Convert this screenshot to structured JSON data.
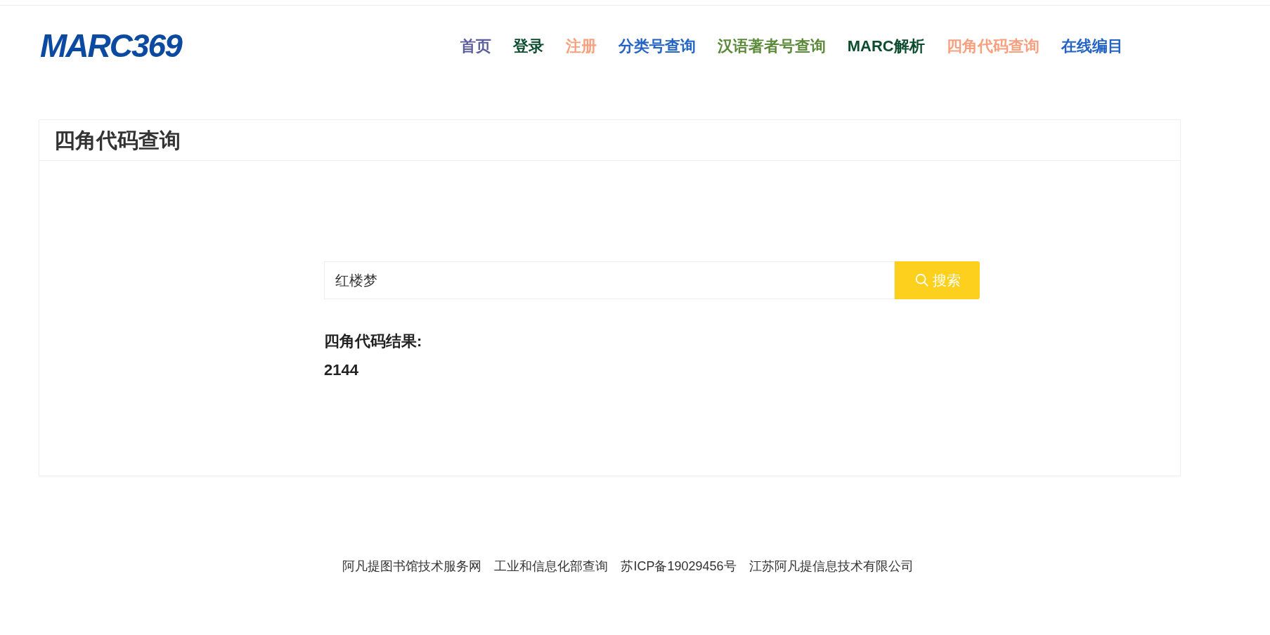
{
  "logo": {
    "text": "MARC369"
  },
  "nav": [
    {
      "label": "首页",
      "color": "#5b5fa0"
    },
    {
      "label": "登录",
      "color": "#0b4d2c"
    },
    {
      "label": "注册",
      "color": "#f8a07e"
    },
    {
      "label": "分类号查询",
      "color": "#2263c5"
    },
    {
      "label": "汉语著者号查询",
      "color": "#5a8a38"
    },
    {
      "label": "MARC解析",
      "color": "#0b4d2c"
    },
    {
      "label": "四角代码查询",
      "color": "#f8a07e"
    },
    {
      "label": "在线编目",
      "color": "#2263c5"
    }
  ],
  "card": {
    "title": "四角代码查询",
    "search": {
      "value": "红楼梦",
      "button": "搜索"
    },
    "result": {
      "label": "四角代码结果:",
      "value": "2144"
    }
  },
  "footer": [
    "阿凡提图书馆技术服务网",
    "工业和信息化部查询",
    "苏ICP备19029456号",
    "江苏阿凡提信息技术有限公司"
  ]
}
